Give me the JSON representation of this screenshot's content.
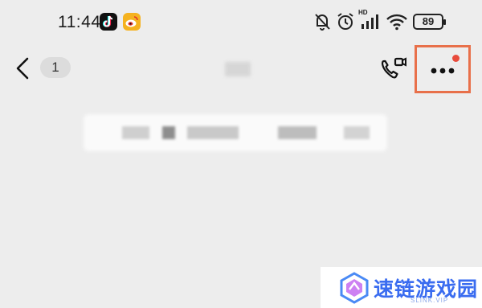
{
  "status_bar": {
    "time": "11:44",
    "notification_icons": [
      "tiktok-icon",
      "weibo-icon"
    ],
    "system_icons": [
      "mute-bell-icon",
      "alarm-icon",
      "hd-signal-icon",
      "wifi-icon",
      "battery-icon"
    ],
    "hd_label": "HD",
    "battery_level": "89"
  },
  "nav_bar": {
    "back_icon": "chevron-left-icon",
    "unread_count": "1",
    "video_call_icon": "phone-video-icon",
    "more_icon": "more-dots-icon",
    "more_dot_color": "#e84b3c",
    "highlight_color": "#e8704a"
  },
  "watermark": {
    "text": "速链游戏园",
    "sub": "SLINK.VIP"
  }
}
